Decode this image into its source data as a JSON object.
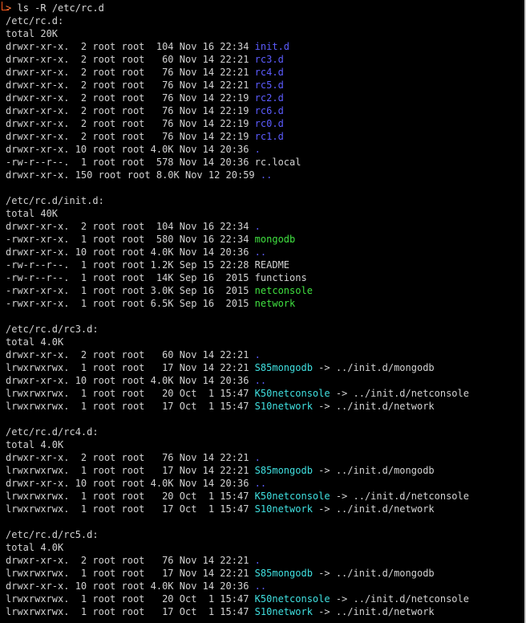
{
  "terminal": {
    "prompt_symbol": ">",
    "command": "ls -R /etc/rc.d",
    "colors": {
      "background": "#000000",
      "text": "#d2d2d2",
      "directory": "#5c5cff",
      "executable": "#40e040",
      "symlink": "#40e0e0",
      "prompt": "#ff5a1c"
    },
    "lines": [
      {
        "type": "text",
        "text": "/etc/rc.d:"
      },
      {
        "type": "text",
        "text": "total 20K"
      },
      {
        "type": "entry",
        "meta": "drwxr-xr-x.  2 root root  104 Nov 16 22:34 ",
        "name": "init.d",
        "kind": "dir",
        "target": ""
      },
      {
        "type": "entry",
        "meta": "drwxr-xr-x.  2 root root   60 Nov 14 22:21 ",
        "name": "rc3.d",
        "kind": "dir",
        "target": ""
      },
      {
        "type": "entry",
        "meta": "drwxr-xr-x.  2 root root   76 Nov 14 22:21 ",
        "name": "rc4.d",
        "kind": "dir",
        "target": ""
      },
      {
        "type": "entry",
        "meta": "drwxr-xr-x.  2 root root   76 Nov 14 22:21 ",
        "name": "rc5.d",
        "kind": "dir",
        "target": ""
      },
      {
        "type": "entry",
        "meta": "drwxr-xr-x.  2 root root   76 Nov 14 22:19 ",
        "name": "rc2.d",
        "kind": "dir",
        "target": ""
      },
      {
        "type": "entry",
        "meta": "drwxr-xr-x.  2 root root   76 Nov 14 22:19 ",
        "name": "rc6.d",
        "kind": "dir",
        "target": ""
      },
      {
        "type": "entry",
        "meta": "drwxr-xr-x.  2 root root   76 Nov 14 22:19 ",
        "name": "rc0.d",
        "kind": "dir",
        "target": ""
      },
      {
        "type": "entry",
        "meta": "drwxr-xr-x.  2 root root   76 Nov 14 22:19 ",
        "name": "rc1.d",
        "kind": "dir",
        "target": ""
      },
      {
        "type": "entry",
        "meta": "drwxr-xr-x. 10 root root 4.0K Nov 14 20:36 ",
        "name": ".",
        "kind": "dir",
        "target": ""
      },
      {
        "type": "entry",
        "meta": "-rw-r--r--.  1 root root  578 Nov 14 20:36 ",
        "name": "rc.local",
        "kind": "txt",
        "target": ""
      },
      {
        "type": "entry",
        "meta": "drwxr-xr-x. 150 root root 8.0K Nov 12 20:59 ",
        "name": "..",
        "kind": "dir",
        "target": ""
      },
      {
        "type": "blank",
        "text": ""
      },
      {
        "type": "text",
        "text": "/etc/rc.d/init.d:"
      },
      {
        "type": "text",
        "text": "total 40K"
      },
      {
        "type": "entry",
        "meta": "drwxr-xr-x.  2 root root  104 Nov 16 22:34 ",
        "name": ".",
        "kind": "dir",
        "target": ""
      },
      {
        "type": "entry",
        "meta": "-rwxr-xr-x.  1 root root  580 Nov 16 22:34 ",
        "name": "mongodb",
        "kind": "exe",
        "target": ""
      },
      {
        "type": "entry",
        "meta": "drwxr-xr-x. 10 root root 4.0K Nov 14 20:36 ",
        "name": "..",
        "kind": "dir",
        "target": ""
      },
      {
        "type": "entry",
        "meta": "-rw-r--r--.  1 root root 1.2K Sep 15 22:28 ",
        "name": "README",
        "kind": "txt",
        "target": ""
      },
      {
        "type": "entry",
        "meta": "-rw-r--r--.  1 root root  14K Sep 16  2015 ",
        "name": "functions",
        "kind": "txt",
        "target": ""
      },
      {
        "type": "entry",
        "meta": "-rwxr-xr-x.  1 root root 3.0K Sep 16  2015 ",
        "name": "netconsole",
        "kind": "exe",
        "target": ""
      },
      {
        "type": "entry",
        "meta": "-rwxr-xr-x.  1 root root 6.5K Sep 16  2015 ",
        "name": "network",
        "kind": "exe",
        "target": ""
      },
      {
        "type": "blank",
        "text": ""
      },
      {
        "type": "text",
        "text": "/etc/rc.d/rc3.d:"
      },
      {
        "type": "text",
        "text": "total 4.0K"
      },
      {
        "type": "entry",
        "meta": "drwxr-xr-x.  2 root root   60 Nov 14 22:21 ",
        "name": ".",
        "kind": "dir",
        "target": ""
      },
      {
        "type": "entry",
        "meta": "lrwxrwxrwx.  1 root root   17 Nov 14 22:21 ",
        "name": "S85mongodb",
        "kind": "lnk",
        "target": " -> ../init.d/mongodb"
      },
      {
        "type": "entry",
        "meta": "drwxr-xr-x. 10 root root 4.0K Nov 14 20:36 ",
        "name": "..",
        "kind": "dir",
        "target": ""
      },
      {
        "type": "entry",
        "meta": "lrwxrwxrwx.  1 root root   20 Oct  1 15:47 ",
        "name": "K50netconsole",
        "kind": "lnk",
        "target": " -> ../init.d/netconsole"
      },
      {
        "type": "entry",
        "meta": "lrwxrwxrwx.  1 root root   17 Oct  1 15:47 ",
        "name": "S10network",
        "kind": "lnk",
        "target": " -> ../init.d/network"
      },
      {
        "type": "blank",
        "text": ""
      },
      {
        "type": "text",
        "text": "/etc/rc.d/rc4.d:"
      },
      {
        "type": "text",
        "text": "total 4.0K"
      },
      {
        "type": "entry",
        "meta": "drwxr-xr-x.  2 root root   76 Nov 14 22:21 ",
        "name": ".",
        "kind": "dir",
        "target": ""
      },
      {
        "type": "entry",
        "meta": "lrwxrwxrwx.  1 root root   17 Nov 14 22:21 ",
        "name": "S85mongodb",
        "kind": "lnk",
        "target": " -> ../init.d/mongodb"
      },
      {
        "type": "entry",
        "meta": "drwxr-xr-x. 10 root root 4.0K Nov 14 20:36 ",
        "name": "..",
        "kind": "dir",
        "target": ""
      },
      {
        "type": "entry",
        "meta": "lrwxrwxrwx.  1 root root   20 Oct  1 15:47 ",
        "name": "K50netconsole",
        "kind": "lnk",
        "target": " -> ../init.d/netconsole"
      },
      {
        "type": "entry",
        "meta": "lrwxrwxrwx.  1 root root   17 Oct  1 15:47 ",
        "name": "S10network",
        "kind": "lnk",
        "target": " -> ../init.d/network"
      },
      {
        "type": "blank",
        "text": ""
      },
      {
        "type": "text",
        "text": "/etc/rc.d/rc5.d:"
      },
      {
        "type": "text",
        "text": "total 4.0K"
      },
      {
        "type": "entry",
        "meta": "drwxr-xr-x.  2 root root   76 Nov 14 22:21 ",
        "name": ".",
        "kind": "dir",
        "target": ""
      },
      {
        "type": "entry",
        "meta": "lrwxrwxrwx.  1 root root   17 Nov 14 22:21 ",
        "name": "S85mongodb",
        "kind": "lnk",
        "target": " -> ../init.d/mongodb"
      },
      {
        "type": "entry",
        "meta": "drwxr-xr-x. 10 root root 4.0K Nov 14 20:36 ",
        "name": "..",
        "kind": "dir",
        "target": ""
      },
      {
        "type": "entry",
        "meta": "lrwxrwxrwx.  1 root root   20 Oct  1 15:47 ",
        "name": "K50netconsole",
        "kind": "lnk",
        "target": " -> ../init.d/netconsole"
      },
      {
        "type": "entry",
        "meta": "lrwxrwxrwx.  1 root root   17 Oct  1 15:47 ",
        "name": "S10network",
        "kind": "lnk",
        "target": " -> ../init.d/network"
      }
    ]
  }
}
